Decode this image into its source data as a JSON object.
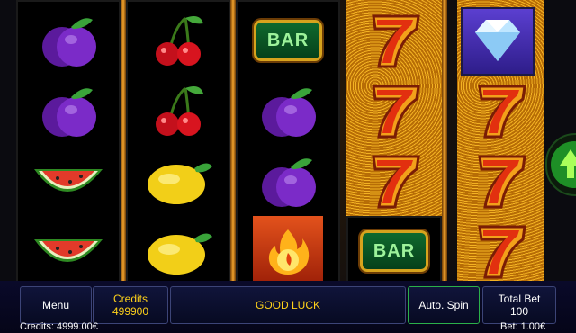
{
  "game": {
    "reels": [
      [
        "plum",
        "plum",
        "watermelon",
        "watermelon"
      ],
      [
        "cherries",
        "cherries",
        "lemon",
        "lemon"
      ],
      [
        "bar",
        "plum",
        "plum",
        "hot-fire"
      ],
      [
        "seven",
        "seven",
        "seven",
        "bar"
      ],
      [
        "diamond",
        "seven",
        "seven",
        "seven"
      ]
    ],
    "bar_label": "BAR"
  },
  "panel": {
    "menu_label": "Menu",
    "credits_label": "Credits",
    "credits_value": "499900",
    "message": "GOOD LUCK",
    "auto_spin_label": "Auto. Spin",
    "total_bet_label": "Total Bet",
    "total_bet_value": "100"
  },
  "footer": {
    "credits_text": "Credits: 4999.00€",
    "bet_text": "Bet: 1.00€"
  },
  "colors": {
    "accent_yellow": "#ffd21a",
    "auto_spin_border": "#2bb04a",
    "panel_bg": "#0a0a2a"
  }
}
